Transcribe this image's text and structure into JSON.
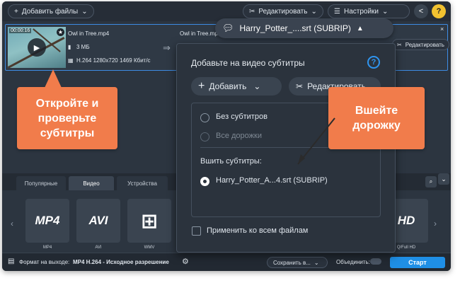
{
  "toolbar": {
    "add_files_label": "Добавить файлы",
    "edit_label": "Редактировать",
    "settings_label": "Настройки"
  },
  "file": {
    "time": "00:00:16",
    "name": "Owl in Tree.mp4",
    "output_name": "Owl in Tree.mp",
    "size": "3 МБ",
    "codec": "H.264 1280x720 1469 Кбит/с",
    "edit_label": "Редактировать"
  },
  "subtitle_pill": {
    "label": "Harry_Potter_....srt (SUBRIP)"
  },
  "popup": {
    "title": "Добавьте на видео субтитры",
    "add_label": "Добавить",
    "edit_label": "Редактировать",
    "options": {
      "none": "Без субтитров",
      "all_tracks": "Все дорожки",
      "burn_label": "Вшить субтитры:",
      "burn_track": "Harry_Potter_A...4.srt (SUBRIP)"
    },
    "apply_all_label": "Применить ко всем файлам"
  },
  "callouts": {
    "left": "Откройте и проверьте субтитры",
    "right": "Вшейте дорожку"
  },
  "tabs": [
    "Популярные",
    "Видео",
    "Устройства"
  ],
  "presets": [
    {
      "logo": "MP4",
      "label": "MP4"
    },
    {
      "logo": "AVI",
      "label": "AVI"
    },
    {
      "logo": "WMV",
      "label": "WMV"
    },
    {
      "logo": "HD",
      "label": "Q/Full HD"
    }
  ],
  "status": {
    "format_label": "Формат на выходе:",
    "format_value": "MP4 H.264 - Исходное разрешение",
    "save_label": "Сохранить в...",
    "merge_label": "Объединить:",
    "start_label": "Старт"
  },
  "colors": {
    "accent": "#1f8fe6",
    "callout": "#f17c4b",
    "help": "#f2c230"
  }
}
